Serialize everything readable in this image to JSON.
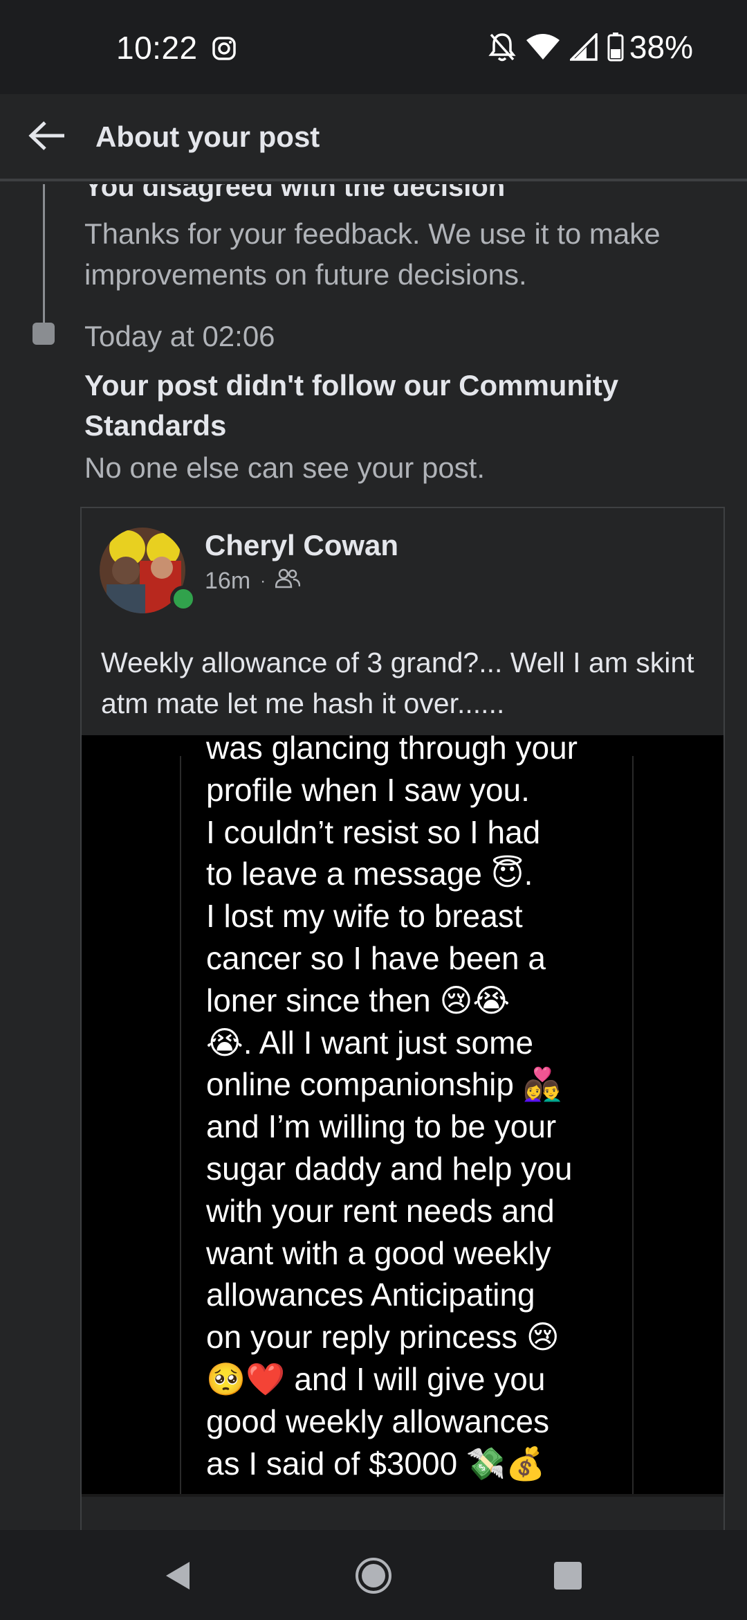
{
  "status_bar": {
    "time": "10:22",
    "battery": "38%",
    "icons": [
      "instagram-icon",
      "bell-off-icon",
      "wifi-icon",
      "signal-icon",
      "battery-icon"
    ]
  },
  "header": {
    "title": "About your post",
    "back_icon": "arrow-left-icon"
  },
  "timeline": {
    "previous": {
      "title": "You disagreed with the decision",
      "description": "Thanks for your feedback. We use it to make improvements on future decisions."
    },
    "event": {
      "time": "Today at 02:06",
      "title": "Your post didn't follow our Community Standards",
      "description": "No one else can see your post."
    }
  },
  "post": {
    "author": "Cheryl Cowan",
    "age": "16m",
    "separator": "·",
    "audience_icon": "friends-icon",
    "text": "Weekly allowance of 3 grand?... Well I am skint atm mate let me hash it over......",
    "image_text": "was glancing through your\nprofile when I saw you.\nI couldn’t resist so I had\nto leave a message 😇.\nI lost my wife to breast\ncancer so I have been a\nloner since then 😢😭\n😭. All I want just some\nonline companionship 👩‍❤️‍👨\nand I’m willing to be your\nsugar daddy and help you\nwith your rent needs and\nwant with a good weekly\nallowances Anticipating\non your reply princess 😢\n🥺❤️ and I will give you\ngood weekly allowances\nas I said of $3000 💸💰"
  },
  "nav_bar": {
    "icons": [
      "back-triangle-icon",
      "home-circle-icon",
      "recents-square-icon"
    ]
  },
  "colors": {
    "background": "#242526",
    "status_bar": "#1c1d1f",
    "primary_text": "#e4e6eb",
    "secondary_text": "#b0b3b8",
    "online_green": "#31a24c"
  }
}
